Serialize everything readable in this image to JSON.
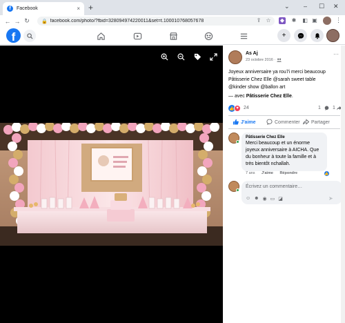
{
  "browser": {
    "tab_title": "Facebook",
    "tab_close": "×",
    "new_tab": "+",
    "url": "facebook.com/photo/?fbid=328094974220011&set=t.100010768057678",
    "window": {
      "chevron": "⌄",
      "minimize": "–",
      "maximize": "☐",
      "close": "✕"
    }
  },
  "nav": {
    "logo": "f"
  },
  "post": {
    "author": "As Aj",
    "date": "23 octobre 2016 ·",
    "caption_line1": "Joyeux anniversaire ya rou7i merci beaucoup",
    "caption_line2": "Pâtisserie Chez Elle @sarah sweet table",
    "caption_line3": "@kinder show @ballon art",
    "with_prefix": "— avec",
    "with_page": "Pâtisserie Chez Elle",
    "with_suffix": ".",
    "reaction_count": "24",
    "comment_count": "1",
    "share_count": "1"
  },
  "actions": {
    "like": "J'aime",
    "comment": "Commenter",
    "share": "Partager"
  },
  "comment": {
    "author": "Pâtisserie Chez Elle",
    "text": "Merci beaucoup et un énorme joyeux anniversaire à AICHA. Que du bonheur à toute la famille et à très bientôt nchallah.",
    "age": "7 ans",
    "like": "J'aime",
    "reply": "Répondre"
  },
  "composer": {
    "placeholder": "Écrivez un commentaire…"
  },
  "colors": {
    "facebook_blue": "#1877f2",
    "love_red": "#f33e58",
    "online_green": "#31a24c"
  }
}
